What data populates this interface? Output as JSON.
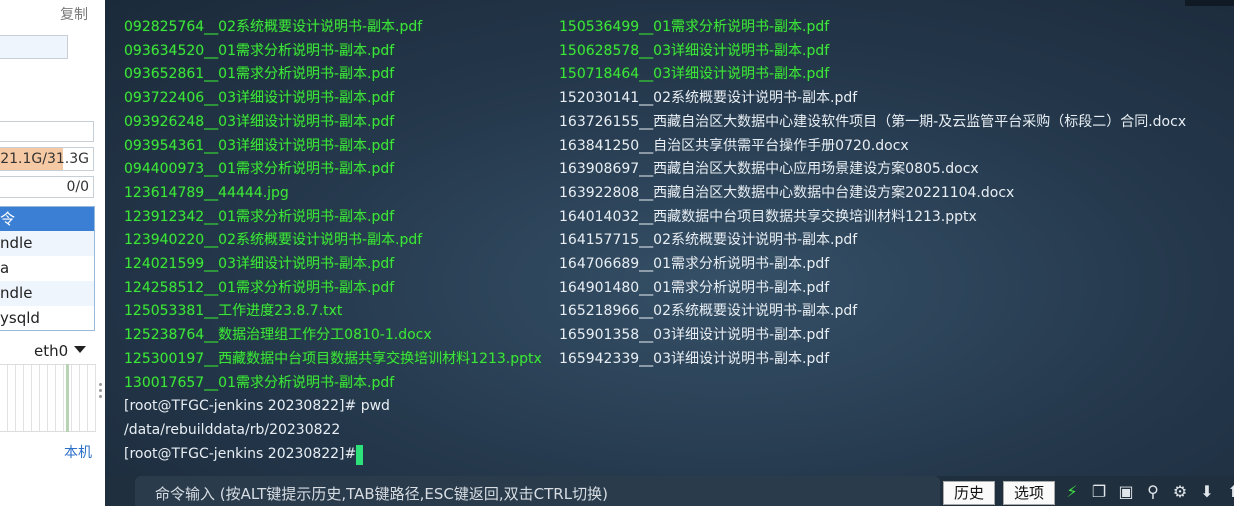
{
  "left_panel": {
    "copy_label": "复制",
    "memory_text": "21.1G/31.3G",
    "memory_fraction": 0.674,
    "swap_text": "0/0",
    "process_header": "令",
    "processes": [
      "ndle",
      "a",
      "ndle",
      "ysqld"
    ],
    "network_interface": "eth0",
    "host_link": "本机"
  },
  "terminal": {
    "col1": [
      {
        "text": "092825764__02系统概要设计说明书-副本.pdf",
        "color": "green"
      },
      {
        "text": "093634520__01需求分析说明书-副本.pdf",
        "color": "green"
      },
      {
        "text": "093652861__01需求分析说明书-副本.pdf",
        "color": "green"
      },
      {
        "text": "093722406__03详细设计说明书-副本.pdf",
        "color": "green"
      },
      {
        "text": "093926248__03详细设计说明书-副本.pdf",
        "color": "green"
      },
      {
        "text": "093954361__03详细设计说明书-副本.pdf",
        "color": "green"
      },
      {
        "text": "094400973__01需求分析说明书-副本.pdf",
        "color": "green"
      },
      {
        "text": "123614789__44444.jpg",
        "color": "green"
      },
      {
        "text": "123912342__01需求分析说明书-副本.pdf",
        "color": "green"
      },
      {
        "text": "123940220__02系统概要设计说明书-副本.pdf",
        "color": "green"
      },
      {
        "text": "124021599__03详细设计说明书-副本.pdf",
        "color": "green"
      },
      {
        "text": "124258512__01需求分析说明书-副本.pdf",
        "color": "green"
      },
      {
        "text": "125053381__工作进度23.8.7.txt",
        "color": "green"
      },
      {
        "text": "125238764__数据治理组工作分工0810-1.docx",
        "color": "green"
      },
      {
        "text": "125300197__西藏数据中台项目数据共享交换培训材料1213.pptx",
        "color": "green"
      },
      {
        "text": "130017657__01需求分析说明书-副本.pdf",
        "color": "green"
      }
    ],
    "col2": [
      {
        "text": "150536499__01需求分析说明书-副本.pdf",
        "color": "green"
      },
      {
        "text": "150628578__03详细设计说明书-副本.pdf",
        "color": "green"
      },
      {
        "text": "150718464__03详细设计说明书-副本.pdf",
        "color": "green"
      },
      {
        "text": "152030141__02系统概要设计说明书-副本.pdf",
        "color": "white"
      },
      {
        "text": "163726155__西藏自治区大数据中心建设软件项目（第一期-及云监管平台采购（标段二）合同.docx",
        "color": "white"
      },
      {
        "text": "163841250__自治区共享供需平台操作手册0720.docx",
        "color": "white"
      },
      {
        "text": "163908697__西藏自治区大数据中心应用场景建设方案0805.docx",
        "color": "white"
      },
      {
        "text": "163922808__西藏自治区大数据中心数据中台建设方案20221104.docx",
        "color": "white"
      },
      {
        "text": "164014032__西藏数据中台项目数据共享交换培训材料1213.pptx",
        "color": "white"
      },
      {
        "text": "164157715__02系统概要设计说明书-副本.pdf",
        "color": "white"
      },
      {
        "text": "164706689__01需求分析说明书-副本.pdf",
        "color": "white"
      },
      {
        "text": "164901480__01需求分析说明书-副本.pdf",
        "color": "white"
      },
      {
        "text": "165218966__02系统概要设计说明书-副本.pdf",
        "color": "white"
      },
      {
        "text": "165901358__03详细设计说明书-副本.pdf",
        "color": "white"
      },
      {
        "text": "165942339__03详细设计说明书-副本.pdf",
        "color": "white"
      }
    ],
    "tail": [
      "[root@TFGC-jenkins 20230822]# pwd",
      "/data/rebuilddata/rb/20230822",
      "[root@TFGC-jenkins 20230822]# "
    ]
  },
  "command_bar": {
    "placeholder": "命令输入 (按ALT键提示历史,TAB键路径,ESC键返回,双击CTRL切换)",
    "history_label": "历史",
    "options_label": "选项",
    "icons": [
      "lightning-icon",
      "copy-icon",
      "paste-icon",
      "search-icon",
      "settings-icon",
      "download-icon",
      "upload-icon"
    ]
  },
  "colors": {
    "terminal_green": "#3ee23e",
    "terminal_white": "#e8eef3",
    "cursor": "#2ee27a",
    "accent_blue": "#3b7fd4"
  }
}
